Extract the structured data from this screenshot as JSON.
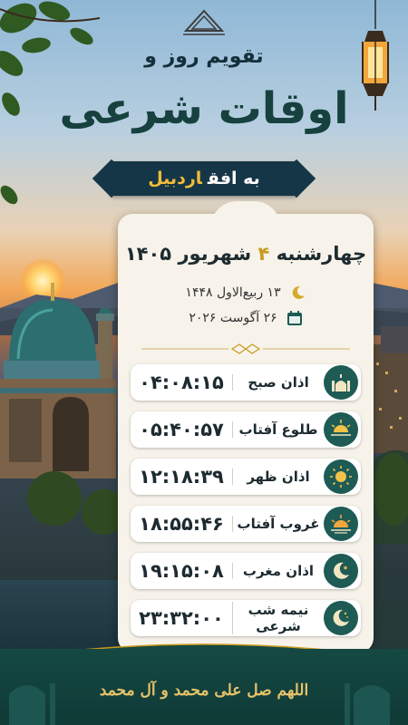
{
  "header": {
    "title_line1": "تقویم روز و",
    "title_line2": "اوقات شرعی",
    "banner_prefix": "به افق",
    "banner_city": "اردبیل"
  },
  "date": {
    "weekday": "چهارشنبه",
    "day": "۴",
    "month_year": "شهریور ۱۴۰۵",
    "hijri": "۱۳ ربیع‌الاول ۱۴۴۸",
    "gregorian": "۲۶ آگوست ۲۰۲۶"
  },
  "times": [
    {
      "label": "اذان صبح",
      "time": "۰۴:۰۸:۱۵",
      "icon": "mosque-icon"
    },
    {
      "label": "طلوع آفتاب",
      "time": "۰۵:۴۰:۵۷",
      "icon": "sunrise-icon"
    },
    {
      "label": "اذان ظهر",
      "time": "۱۲:۱۸:۳۹",
      "icon": "sun-icon"
    },
    {
      "label": "غروب آفتاب",
      "time": "۱۸:۵۵:۴۶",
      "icon": "sunset-icon"
    },
    {
      "label": "اذان مغرب",
      "time": "۱۹:۱۵:۰۸",
      "icon": "crescent-icon"
    },
    {
      "label": "نیمه شب شرعی",
      "time": "۲۳:۳۲:۰۰",
      "icon": "night-icon"
    }
  ],
  "footer": {
    "salawat": "اللهم صل علی محمد و آل محمد"
  },
  "colors": {
    "accent_gold": "#c99a1e",
    "badge_green": "#1e5b55",
    "banner_navy": "#153646"
  }
}
